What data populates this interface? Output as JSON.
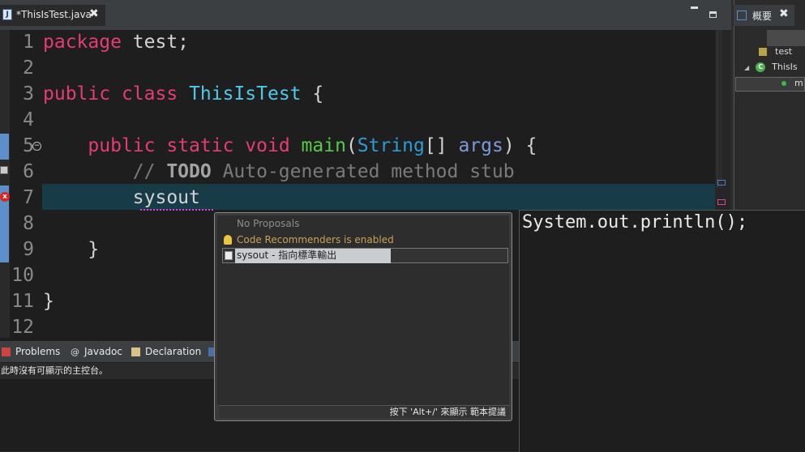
{
  "editor_tab": {
    "title": "*ThisIsTest.java",
    "close": "✖"
  },
  "outline": {
    "tab_title": "概要",
    "close": "✖",
    "rows": {
      "package": "test",
      "class": "ThisIs",
      "method": "m"
    }
  },
  "code": {
    "line_numbers": [
      "1",
      "2",
      "3",
      "4",
      "5",
      "6",
      "7",
      "8",
      "9",
      "10",
      "11",
      "12"
    ],
    "line1_kw": "package",
    "line1_rest": " test;",
    "line3_kw1": "public",
    "line3_kw2": "class",
    "line3_cls": "ThisIsTest",
    "line3_rest": " {",
    "line5_kw1": "public",
    "line5_kw2": "static",
    "line5_kw3": "void",
    "line5_fn": "main",
    "line5_paren": "(",
    "line5_type": "String",
    "line5_brk": "[] ",
    "line5_var": "args",
    "line5_rest": ") {",
    "line6_cmt1": "// ",
    "line6_todo": "TODO",
    "line6_cmt2": " Auto-generated method stub",
    "line7_text": "sysout",
    "line9_text": "}",
    "line11_text": "}"
  },
  "bottom_panel": {
    "tabs": [
      "Problems",
      "Javadoc",
      "Declaration"
    ],
    "console_message": "此時沒有可顯示的主控台。"
  },
  "content_assist": {
    "items": [
      "No Proposals",
      "Code Recommenders is enabled",
      "sysout - 指向標準輸出"
    ],
    "status": "按下 'Alt+/' 來顯示 範本提議"
  },
  "info_popup": {
    "text": "System.out.println();"
  },
  "colors": {
    "keyword": "#e33c77",
    "class": "#4ec9e8",
    "function": "#57c94a",
    "type": "#2e9bd7",
    "current_line": "#173b47"
  }
}
